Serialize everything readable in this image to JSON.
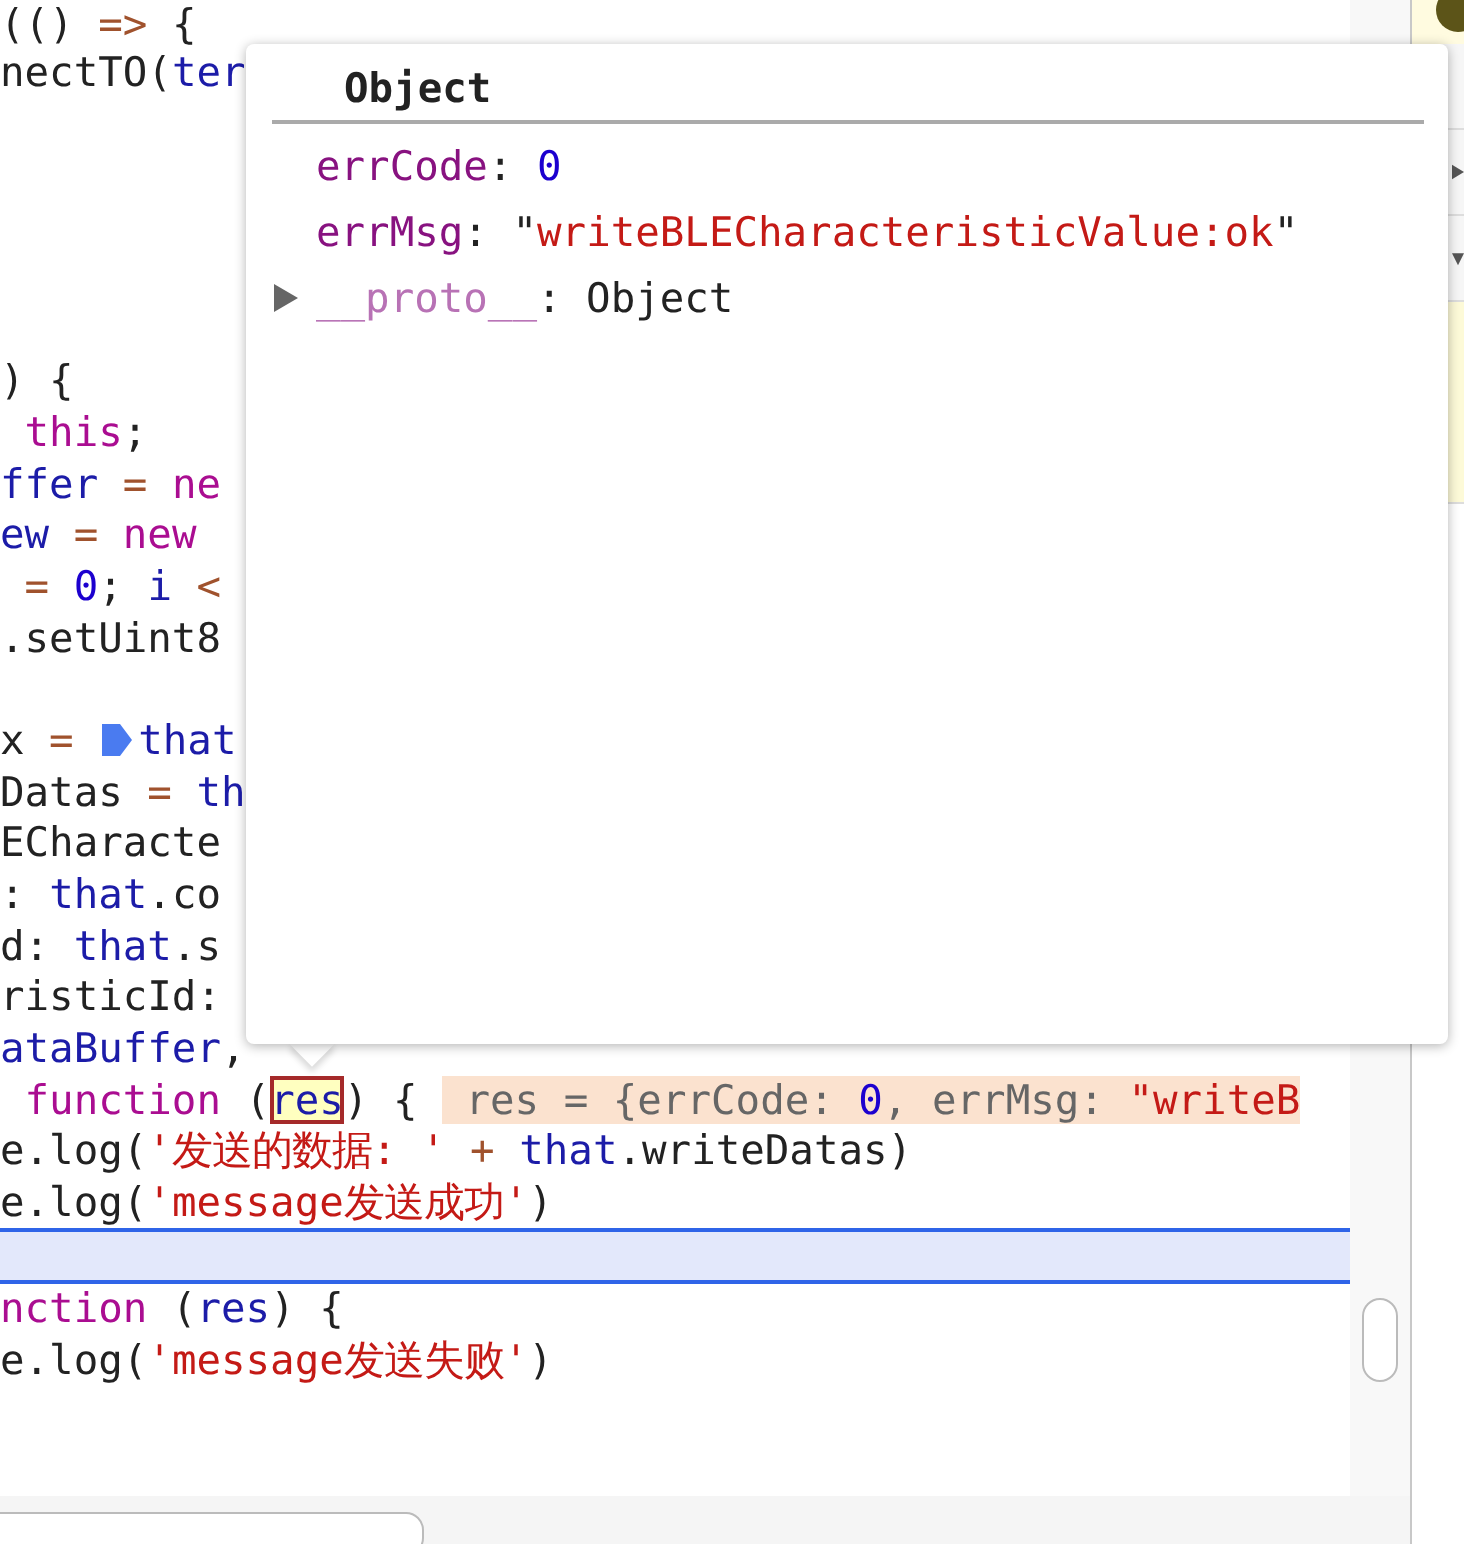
{
  "editor": {
    "lines": [
      {
        "current": false,
        "tokens": [
          {
            "kind": "plain",
            "text": "(() "
          },
          {
            "kind": "operator",
            "text": "=>"
          },
          {
            "kind": "plain",
            "text": " {"
          }
        ]
      },
      {
        "current": false,
        "tokens": [
          {
            "kind": "plain",
            "text": "nectTO("
          },
          {
            "kind": "variable",
            "text": "ter"
          }
        ]
      },
      {
        "current": false
      },
      {
        "current": false
      },
      {
        "current": false
      },
      {
        "current": false
      },
      {
        "current": false
      },
      {
        "current": false,
        "tokens": [
          {
            "kind": "plain",
            "text": ") {"
          }
        ]
      },
      {
        "current": false,
        "tokens": [
          {
            "kind": "keyword",
            "text": " this"
          },
          {
            "kind": "plain",
            "text": ";"
          }
        ]
      },
      {
        "current": false,
        "tokens": [
          {
            "kind": "variable",
            "text": "ffer"
          },
          {
            "kind": "operator",
            "text": " = "
          },
          {
            "kind": "keyword",
            "text": "ne"
          }
        ]
      },
      {
        "current": false,
        "tokens": [
          {
            "kind": "variable",
            "text": "ew"
          },
          {
            "kind": "operator",
            "text": " = "
          },
          {
            "kind": "keyword",
            "text": "new"
          }
        ]
      },
      {
        "current": false,
        "tokens": [
          {
            "kind": "operator",
            "text": " = "
          },
          {
            "kind": "number",
            "text": "0"
          },
          {
            "kind": "plain",
            "text": "; "
          },
          {
            "kind": "variable",
            "text": "i"
          },
          {
            "kind": "operator",
            "text": " <"
          }
        ]
      },
      {
        "current": false,
        "tokens": [
          {
            "kind": "plain",
            "text": ".setUint8"
          }
        ]
      },
      {
        "current": false
      },
      {
        "current": false,
        "tokens": [
          {
            "kind": "plain",
            "text": "x"
          },
          {
            "kind": "operator",
            "text": " = "
          },
          {
            "kind": "breakpoint"
          },
          {
            "kind": "variable",
            "text": "that"
          }
        ]
      },
      {
        "current": false,
        "tokens": [
          {
            "kind": "plain",
            "text": "Datas"
          },
          {
            "kind": "operator",
            "text": " = "
          },
          {
            "kind": "variable",
            "text": "th"
          }
        ]
      },
      {
        "current": false,
        "tokens": [
          {
            "kind": "plain",
            "text": "ECharacte"
          }
        ]
      },
      {
        "current": false,
        "tokens": [
          {
            "kind": "plain",
            "text": ": "
          },
          {
            "kind": "variable",
            "text": "that"
          },
          {
            "kind": "plain",
            "text": ".co"
          }
        ]
      },
      {
        "current": false,
        "tokens": [
          {
            "kind": "plain",
            "text": "d: "
          },
          {
            "kind": "variable",
            "text": "that"
          },
          {
            "kind": "plain",
            "text": ".s"
          }
        ]
      },
      {
        "current": false,
        "tokens": [
          {
            "kind": "plain",
            "text": "risticId:"
          }
        ]
      },
      {
        "current": false,
        "tokens": [
          {
            "kind": "variable",
            "text": "ataBuffer"
          },
          {
            "kind": "plain",
            "text": ","
          }
        ]
      },
      {
        "current": false,
        "tokens": [
          {
            "kind": "keyword",
            "text": " function"
          },
          {
            "kind": "plain",
            "text": " ("
          },
          {
            "kind": "hovered",
            "text": "res"
          },
          {
            "kind": "plain",
            "text": ") {"
          },
          {
            "kind": "inline_value",
            "parts": [
              {
                "kind": "dim",
                "text": "res = {errCode: "
              },
              {
                "kind": "number",
                "text": "0"
              },
              {
                "kind": "dim",
                "text": ", errMsg: "
              },
              {
                "kind": "string",
                "text": "\"writeB"
              }
            ]
          }
        ]
      },
      {
        "current": false,
        "tokens": [
          {
            "kind": "plain",
            "text": "e.log("
          },
          {
            "kind": "string",
            "text": "'发送的数据: '"
          },
          {
            "kind": "operator",
            "text": " + "
          },
          {
            "kind": "variable",
            "text": "that"
          },
          {
            "kind": "plain",
            "text": ".writeDatas)"
          }
        ]
      },
      {
        "current": false,
        "tokens": [
          {
            "kind": "plain",
            "text": "e.log("
          },
          {
            "kind": "string",
            "text": "'message发送成功'"
          },
          {
            "kind": "plain",
            "text": ")"
          }
        ]
      },
      {
        "current": true
      },
      {
        "current": false,
        "tokens": [
          {
            "kind": "keyword",
            "text": "nction"
          },
          {
            "kind": "plain",
            "text": " ("
          },
          {
            "kind": "variable",
            "text": "res"
          },
          {
            "kind": "plain",
            "text": ") {"
          }
        ]
      },
      {
        "current": false,
        "tokens": [
          {
            "kind": "plain",
            "text": "e.log("
          },
          {
            "kind": "string",
            "text": "'message发送失败'"
          },
          {
            "kind": "plain",
            "text": ")"
          }
        ]
      }
    ]
  },
  "popover": {
    "title": "Object",
    "properties": [
      {
        "kind": "own",
        "key": "errCode",
        "expandable": false,
        "value": [
          {
            "kind": "plain",
            "text": ": "
          },
          {
            "kind": "number",
            "text": "0"
          }
        ]
      },
      {
        "kind": "own",
        "key": "errMsg",
        "expandable": false,
        "value": [
          {
            "kind": "plain",
            "text": ": \""
          },
          {
            "kind": "string",
            "text": "writeBLECharacteristicValue:ok"
          },
          {
            "kind": "plain",
            "text": "\""
          }
        ]
      },
      {
        "kind": "proto",
        "key": "__proto__",
        "expandable": true,
        "value": [
          {
            "kind": "plain",
            "text": ": Object"
          }
        ]
      }
    ]
  }
}
